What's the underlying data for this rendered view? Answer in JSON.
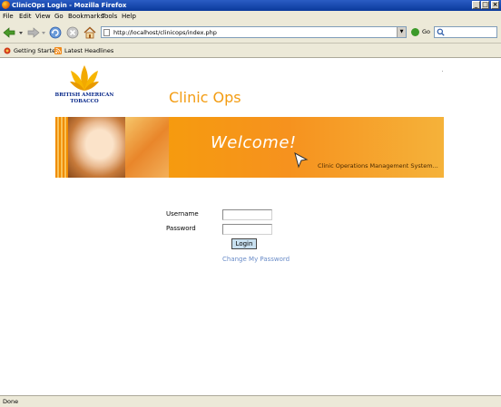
{
  "window": {
    "title": "ClinicOps Login - Mozilla Firefox",
    "controls": [
      "_",
      "□",
      "×"
    ]
  },
  "menu": {
    "items": [
      "File",
      "Edit",
      "View",
      "Go",
      "Bookmarks",
      "Tools",
      "Help"
    ]
  },
  "toolbar": {
    "url": "http://localhost/clinicops/index.php",
    "go_label": "Go",
    "search_value": ""
  },
  "bookmarks": {
    "items": [
      {
        "label": "Getting Started",
        "icon": "getting-started-icon"
      },
      {
        "label": "Latest Headlines",
        "icon": "rss-feed-icon"
      }
    ]
  },
  "page": {
    "logo_text": "BRITISH AMERICAN TOBACCO",
    "app_title": "Clinic Ops",
    "banner": {
      "welcome": "Welcome!",
      "subtitle": "Clinic Operations Management System..."
    },
    "login": {
      "username_label": "Username",
      "password_label": "Password",
      "username_value": "",
      "password_value": "",
      "login_button": "Login",
      "change_password_link": "Change My Password"
    }
  },
  "status": {
    "text": "Done"
  },
  "colors": {
    "accent_orange": "#f39c12",
    "link": "#6a8cc8",
    "logo_blue": "#0a2a8a"
  }
}
